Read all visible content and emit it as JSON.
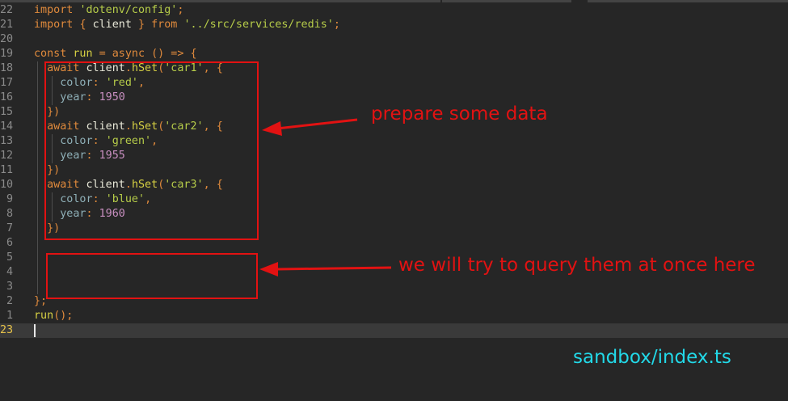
{
  "editor": {
    "lines": [
      {
        "num": "22",
        "tokens": [
          [
            "kw",
            "import "
          ],
          [
            "str",
            "'dotenv/config'"
          ],
          [
            "punc",
            ";"
          ]
        ]
      },
      {
        "num": "21",
        "tokens": [
          [
            "kw",
            "import "
          ],
          [
            "punc",
            "{ "
          ],
          [
            "id",
            "client "
          ],
          [
            "punc",
            "} "
          ],
          [
            "kw",
            "from "
          ],
          [
            "str",
            "'../src/services/redis'"
          ],
          [
            "punc",
            ";"
          ]
        ]
      },
      {
        "num": "20",
        "tokens": []
      },
      {
        "num": "19",
        "tokens": [
          [
            "kw",
            "const "
          ],
          [
            "fn",
            "run "
          ],
          [
            "punc",
            "= "
          ],
          [
            "kw",
            "async "
          ],
          [
            "punc",
            "() => {"
          ]
        ]
      },
      {
        "num": "18",
        "tokens": [
          [
            "kw",
            "  await "
          ],
          [
            "id",
            "client"
          ],
          [
            "punc",
            "."
          ],
          [
            "fn",
            "hSet"
          ],
          [
            "punc",
            "("
          ],
          [
            "str",
            "'car1'"
          ],
          [
            "punc",
            ", {"
          ]
        ]
      },
      {
        "num": "17",
        "tokens": [
          [
            "prop",
            "    color"
          ],
          [
            "punc",
            ": "
          ],
          [
            "str",
            "'red'"
          ],
          [
            "punc",
            ","
          ]
        ]
      },
      {
        "num": "16",
        "tokens": [
          [
            "prop",
            "    year"
          ],
          [
            "punc",
            ": "
          ],
          [
            "num",
            "1950"
          ]
        ]
      },
      {
        "num": "15",
        "tokens": [
          [
            "punc",
            "  })"
          ]
        ]
      },
      {
        "num": "14",
        "tokens": [
          [
            "kw",
            "  await "
          ],
          [
            "id",
            "client"
          ],
          [
            "punc",
            "."
          ],
          [
            "fn",
            "hSet"
          ],
          [
            "punc",
            "("
          ],
          [
            "str",
            "'car2'"
          ],
          [
            "punc",
            ", {"
          ]
        ]
      },
      {
        "num": "13",
        "tokens": [
          [
            "prop",
            "    color"
          ],
          [
            "punc",
            ": "
          ],
          [
            "str",
            "'green'"
          ],
          [
            "punc",
            ","
          ]
        ]
      },
      {
        "num": "12",
        "tokens": [
          [
            "prop",
            "    year"
          ],
          [
            "punc",
            ": "
          ],
          [
            "num",
            "1955"
          ]
        ]
      },
      {
        "num": "11",
        "tokens": [
          [
            "punc",
            "  })"
          ]
        ]
      },
      {
        "num": "10",
        "tokens": [
          [
            "kw",
            "  await "
          ],
          [
            "id",
            "client"
          ],
          [
            "punc",
            "."
          ],
          [
            "fn",
            "hSet"
          ],
          [
            "punc",
            "("
          ],
          [
            "str",
            "'car3'"
          ],
          [
            "punc",
            ", {"
          ]
        ]
      },
      {
        "num": "9",
        "tokens": [
          [
            "prop",
            "    color"
          ],
          [
            "punc",
            ": "
          ],
          [
            "str",
            "'blue'"
          ],
          [
            "punc",
            ","
          ]
        ]
      },
      {
        "num": "8",
        "tokens": [
          [
            "prop",
            "    year"
          ],
          [
            "punc",
            ": "
          ],
          [
            "num",
            "1960"
          ]
        ]
      },
      {
        "num": "7",
        "tokens": [
          [
            "punc",
            "  })"
          ]
        ]
      },
      {
        "num": "6",
        "tokens": []
      },
      {
        "num": "5",
        "tokens": []
      },
      {
        "num": "4",
        "tokens": []
      },
      {
        "num": "3",
        "tokens": []
      },
      {
        "num": "2",
        "tokens": [
          [
            "punc",
            "};"
          ]
        ]
      },
      {
        "num": "1",
        "tokens": [
          [
            "fn",
            "run"
          ],
          [
            "punc",
            "();"
          ]
        ]
      },
      {
        "num": "23",
        "tokens": [],
        "current": true
      }
    ]
  },
  "annotations": {
    "prepare_label": "prepare some data",
    "query_label": "we will try to query them at once here",
    "filename": "sandbox/index.ts"
  },
  "colors": {
    "annotation": "#e21212",
    "filename": "#22d9e8",
    "background": "#262626"
  }
}
